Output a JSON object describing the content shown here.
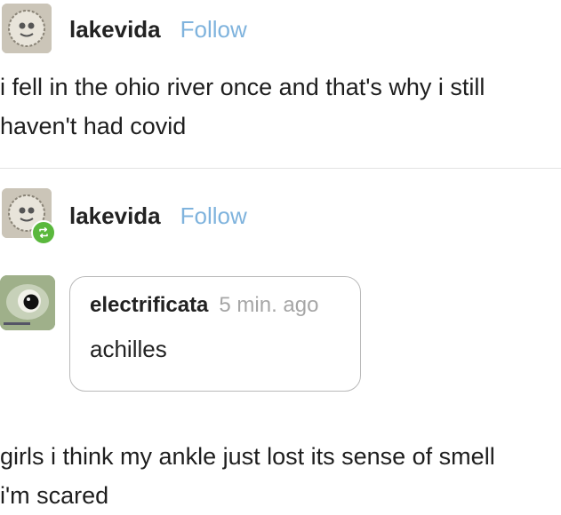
{
  "post": {
    "username": "lakevida",
    "follow_label": "Follow",
    "text_lines": [
      "i fell in the ohio river once and that's why i still",
      "haven't had covid"
    ]
  },
  "reblog": {
    "username": "lakevida",
    "follow_label": "Follow",
    "badge_icon": "reblog-icon",
    "badge_color": "#5ab83d"
  },
  "ask": {
    "username": "electrificata",
    "time": "5 min. ago",
    "question": "achilles"
  },
  "answer": {
    "text_lines": [
      "girls i think my ankle just lost its sense of smell",
      "i'm scared"
    ]
  },
  "colors": {
    "follow": "#7fb3dd",
    "timestamp": "#a6a6a6"
  }
}
